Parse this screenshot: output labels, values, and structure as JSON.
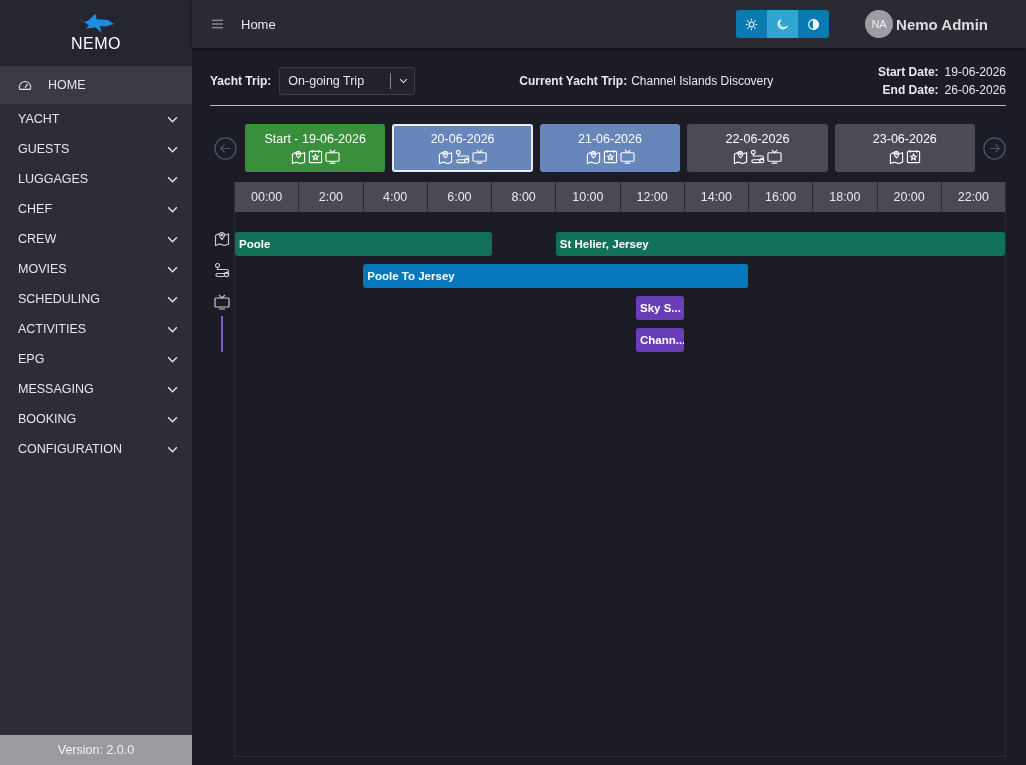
{
  "sidebar": {
    "logo": "NEMO",
    "items": [
      {
        "label": "HOME",
        "selected": true,
        "kind": "home"
      },
      {
        "label": "YACHT",
        "selected": false,
        "kind": "group"
      },
      {
        "label": "GUESTS",
        "selected": false,
        "kind": "group"
      },
      {
        "label": "LUGGAGES",
        "selected": false,
        "kind": "group"
      },
      {
        "label": "CHEF",
        "selected": false,
        "kind": "group"
      },
      {
        "label": "CREW",
        "selected": false,
        "kind": "group"
      },
      {
        "label": "MOVIES",
        "selected": false,
        "kind": "group"
      },
      {
        "label": "SCHEDULING",
        "selected": false,
        "kind": "group"
      },
      {
        "label": "ACTIVITIES",
        "selected": false,
        "kind": "group"
      },
      {
        "label": "EPG",
        "selected": false,
        "kind": "group"
      },
      {
        "label": "MESSAGING",
        "selected": false,
        "kind": "group"
      },
      {
        "label": "BOOKING",
        "selected": false,
        "kind": "group"
      },
      {
        "label": "CONFIGURATION",
        "selected": false,
        "kind": "group"
      }
    ],
    "version": "Version: 2.0.0"
  },
  "header": {
    "breadcrumb": "Home",
    "theme_buttons": [
      {
        "kind": "light",
        "selected": false
      },
      {
        "kind": "dark",
        "selected": true
      },
      {
        "kind": "contrast",
        "selected": false
      }
    ],
    "user": {
      "initials": "NA",
      "name": "Nemo Admin"
    }
  },
  "trip_bar": {
    "label": "Yacht Trip:",
    "select_value": "On-going Trip",
    "current_label": "Current Yacht Trip:",
    "current_value": "Channel Islands Discovery",
    "start_label": "Start Date:",
    "start_value": "19-06-2026",
    "end_label": "End Date:",
    "end_value": "26-06-2026"
  },
  "days": [
    {
      "label": "Start - 19-06-2026",
      "kind": "start",
      "selected": false,
      "icons": [
        {
          "kind": "location"
        },
        {
          "kind": "activity"
        },
        {
          "kind": "tv"
        }
      ]
    },
    {
      "label": "20-06-2026",
      "kind": "active",
      "selected": true,
      "icons": [
        {
          "kind": "location"
        },
        {
          "kind": "transfer"
        },
        {
          "kind": "tv"
        }
      ]
    },
    {
      "label": "21-06-2026",
      "kind": "active",
      "selected": false,
      "icons": [
        {
          "kind": "location"
        },
        {
          "kind": "activity"
        },
        {
          "kind": "tv"
        }
      ]
    },
    {
      "label": "22-06-2026",
      "kind": "upcoming",
      "selected": false,
      "icons": [
        {
          "kind": "location"
        },
        {
          "kind": "transfer"
        },
        {
          "kind": "tv"
        }
      ]
    },
    {
      "label": "23-06-2026",
      "kind": "upcoming",
      "selected": false,
      "icons": [
        {
          "kind": "location"
        },
        {
          "kind": "activity"
        }
      ]
    }
  ],
  "timeline": {
    "hours": [
      "00:00",
      "2:00",
      "4:00",
      "6:00",
      "8:00",
      "10:00",
      "12:00",
      "14:00",
      "16:00",
      "18:00",
      "20:00",
      "22:00"
    ],
    "lanes": [
      {
        "kind": "location",
        "rows": [
          [
            {
              "label": "Poole",
              "color": "#127259"
            },
            {
              "label": "St Helier, Jersey",
              "color": "#127259"
            }
          ]
        ]
      },
      {
        "kind": "transfer",
        "rows": [
          [
            {
              "label": "Poole To Jersey",
              "color": "#0577bd"
            }
          ]
        ]
      },
      {
        "kind": "tv",
        "rows": [
          [
            {
              "label": "Sky S...",
              "color": "#6a3db8"
            }
          ],
          [
            {
              "label": "Chann...",
              "color": "#6a3db8"
            }
          ]
        ]
      }
    ]
  }
}
